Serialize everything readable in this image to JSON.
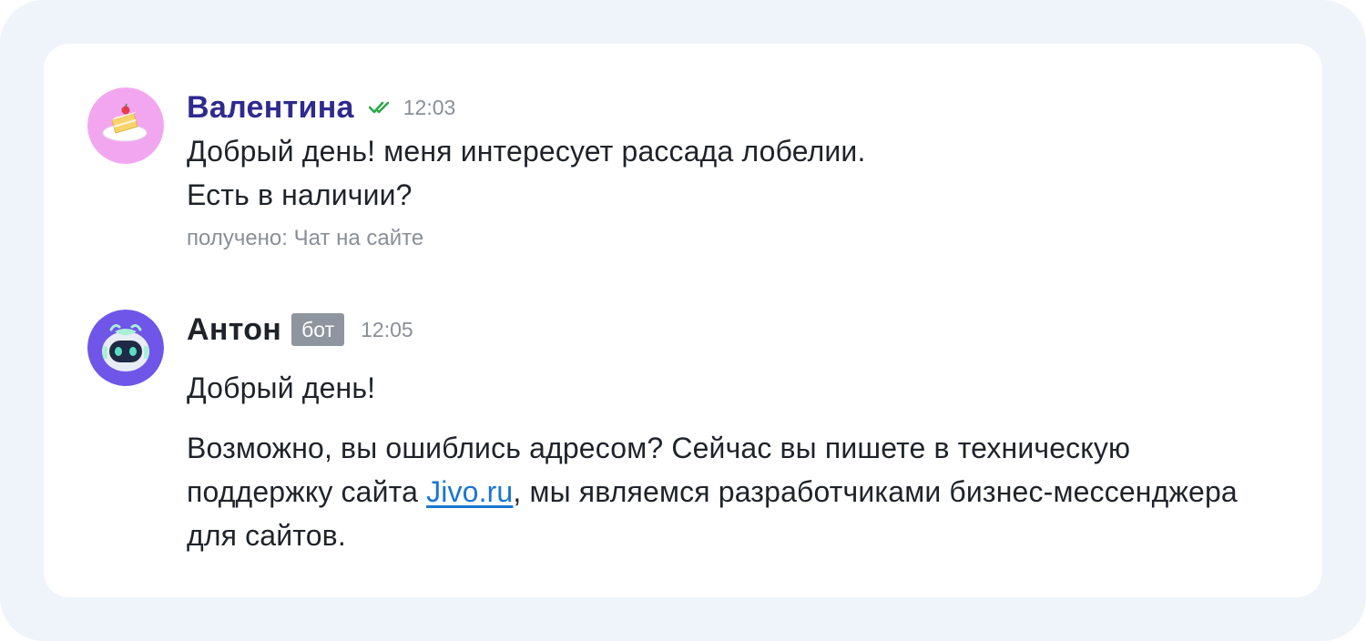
{
  "messages": {
    "client": {
      "avatar_icon": "cake-slice-icon",
      "avatar_bg": "#f3a6f0",
      "name": "Валентина",
      "name_color": "#2f2a8f",
      "status_icon": "double-check-icon",
      "status_color": "#2da84a",
      "time": "12:03",
      "line1": "Добрый день! меня интересует рассада лобелии.",
      "line2": "Есть в наличии?",
      "source": "получено: Чат на сайте"
    },
    "agent": {
      "avatar_icon": "robot-icon",
      "avatar_bg": "#6f56e8",
      "name": "Антон",
      "badge": "бот",
      "time": "12:05",
      "greeting": "Добрый день!",
      "body_before_link": "Возможно, вы ошиблись адресом? Сейчас вы пишете в техническую поддержку сайта ",
      "link_text": "Jivo.ru",
      "link_color": "#1976d2",
      "body_after_link": ", мы являемся разработчиками бизнес-мессенджера для сайтов."
    }
  }
}
